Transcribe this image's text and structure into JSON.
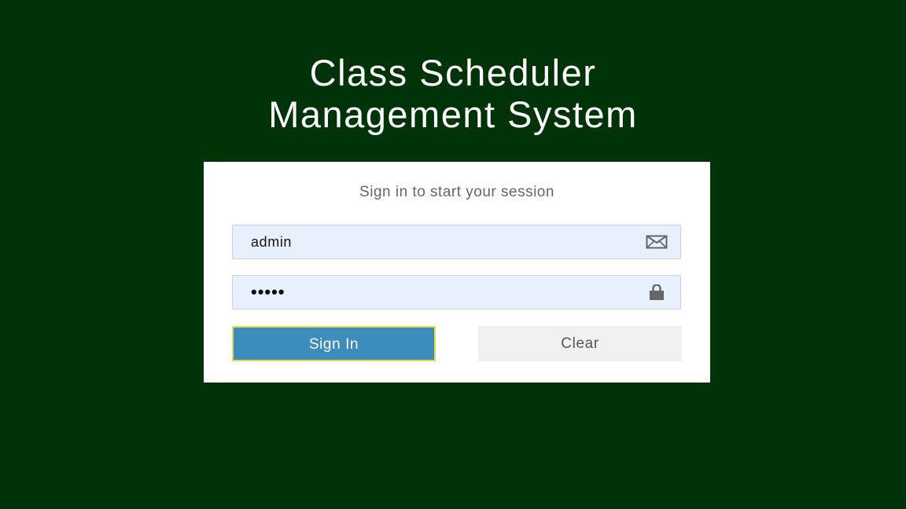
{
  "app": {
    "title_line1": "Class Scheduler",
    "title_line2": "Management System"
  },
  "login": {
    "message": "Sign in to start your session",
    "username": {
      "value": "admin",
      "icon": "envelope-icon"
    },
    "password": {
      "value": "•••••",
      "icon": "lock-icon"
    },
    "signin_label": "Sign In",
    "clear_label": "Clear"
  },
  "colors": {
    "background": "#003308",
    "primary_button": "#3c8dbc",
    "input_fill": "#e8f0fe",
    "focus_outline": "#e8d94a"
  }
}
